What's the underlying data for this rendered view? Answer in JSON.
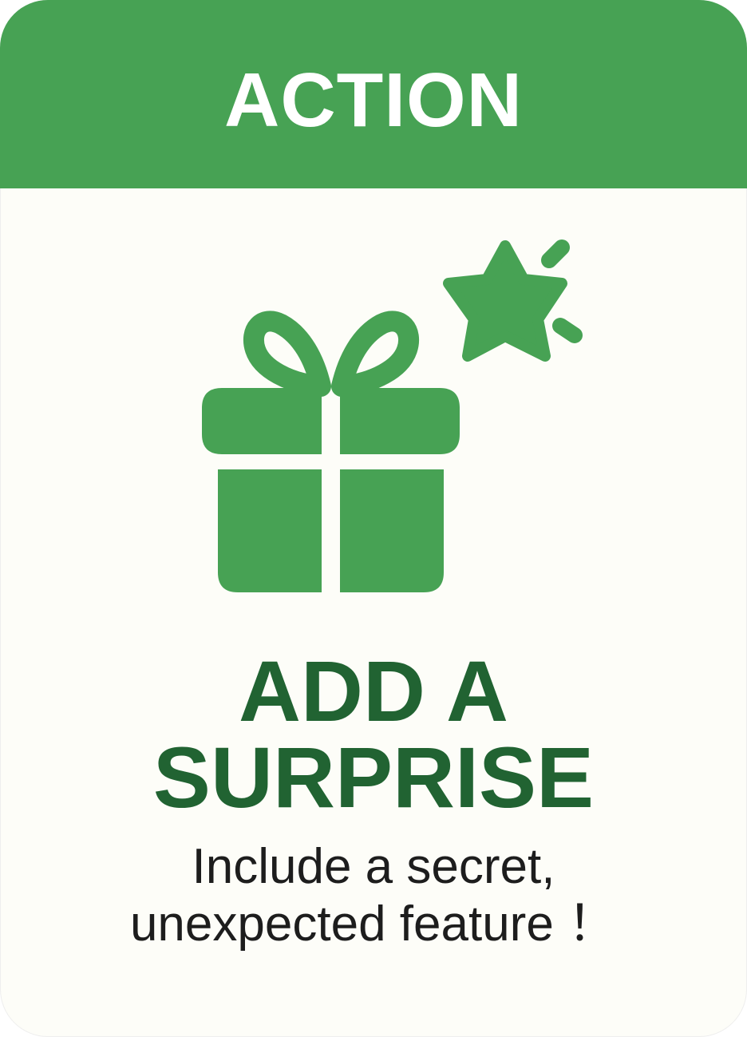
{
  "card": {
    "category": "ACTION",
    "title_lines": [
      "ADD A",
      "SURPRISE"
    ],
    "description_lines": [
      "Include a secret,",
      "unexpected feature ！"
    ],
    "icons": [
      "gift-icon",
      "star-icon",
      "sparkle-icon"
    ],
    "colors": {
      "header": "#47a254",
      "icon": "#47a254",
      "title": "#216332",
      "text": "#1d1d1d",
      "background": "#fdfdf8"
    }
  }
}
